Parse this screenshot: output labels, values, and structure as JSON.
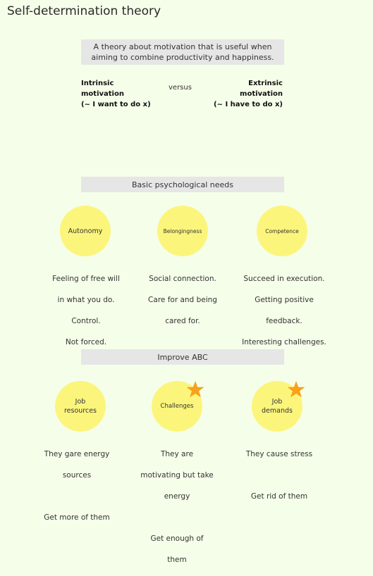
{
  "title": "Self-determination theory",
  "intro": {
    "line1": "A theory about motivation that is useful when",
    "line2": "aiming to combine productivity and happiness."
  },
  "intrinsic": {
    "line1": "Intrinsic",
    "line2": "motivation",
    "line3": "(~ I want to do x)"
  },
  "versus": "versus",
  "extrinsic": {
    "line1": "Extrinsic",
    "line2": "motivation",
    "line3": "(~ I have to do x)"
  },
  "needs_banner": "Basic psychological needs",
  "needs": [
    {
      "label": "Autonomy",
      "desc": [
        "Feeling of free will",
        "in what you do.",
        "Control.",
        "Not forced."
      ]
    },
    {
      "label": "Belongingness",
      "desc": [
        "Social connection.",
        "Care for and being",
        "cared for."
      ]
    },
    {
      "label": "Competence",
      "desc": [
        "Succeed in execution.",
        "Getting positive",
        "feedback.",
        "Interesting challenges."
      ]
    }
  ],
  "abc_banner": "Improve ABC",
  "abc": [
    {
      "label_line1": "Job",
      "label_line2": "resources",
      "desc1": [
        "They gare energy",
        "sources"
      ],
      "desc2": [
        "Get more of them"
      ],
      "starred": false
    },
    {
      "label_line1": "Challenges",
      "label_line2": "",
      "desc1": [
        "They are",
        "motivating but take",
        "energy"
      ],
      "desc2": [
        "Get enough of",
        "them"
      ],
      "starred": true
    },
    {
      "label_line1": "Job",
      "label_line2": "demands",
      "desc1": [
        "They cause stress"
      ],
      "desc2": [
        "Get rid of them"
      ],
      "starred": true
    }
  ],
  "colors": {
    "background": "#f5fee9",
    "circle": "#fcf57c",
    "banner": "#e6e6e6",
    "star": "#f7a21b"
  }
}
